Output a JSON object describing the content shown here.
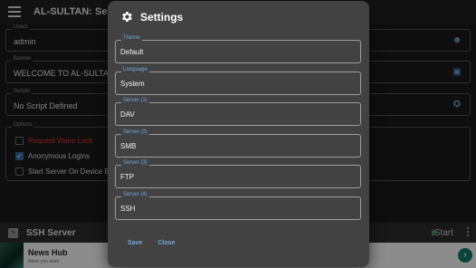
{
  "app": {
    "title": "AL-SULTAN: Serve"
  },
  "background": {
    "users": {
      "label": "Users",
      "value": "admin",
      "icon": "users-icon"
    },
    "banner": {
      "label": "Banner",
      "value": "WELCOME TO AL-SULTAN",
      "icon": "chat-icon"
    },
    "scripts": {
      "label": "Scripts",
      "value": "No Script Defined",
      "icon": "walk-icon"
    },
    "options": {
      "label": "Options",
      "items": [
        {
          "label": "Request Wake Lock",
          "checked": false,
          "color": "#e53935"
        },
        {
          "label": "Anonymous Logins",
          "checked": true
        },
        {
          "label": "Start Server On Device Bo",
          "checked": false
        }
      ]
    },
    "server_bar": {
      "title": "SSH Server",
      "action": "Start"
    },
    "ad": {
      "title": "News Hub",
      "subtitle": "News you want",
      "button_icon": "chevron-right-icon"
    }
  },
  "dialog": {
    "title": "Settings",
    "icon": "gear-icon",
    "fields": [
      {
        "label": "Theme",
        "value": "Default"
      },
      {
        "label": "Language",
        "value": "System"
      },
      {
        "label": "Server (1)",
        "value": "DAV"
      },
      {
        "label": "Server (2)",
        "value": "SMB"
      },
      {
        "label": "Server (3)",
        "value": "FTP"
      },
      {
        "label": "Server (4)",
        "value": "SSH"
      }
    ],
    "actions": {
      "save": "Save",
      "close": "Close"
    }
  },
  "colors": {
    "accent": "#6fa8dc",
    "dialog_bg": "#424242",
    "play": "#3e9e50"
  }
}
